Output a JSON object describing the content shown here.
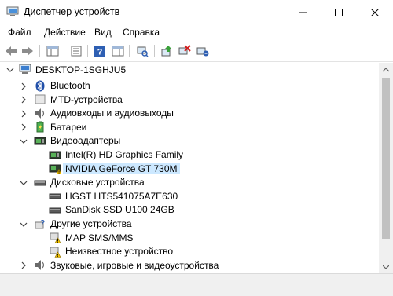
{
  "window": {
    "title": "Диспетчер устройств"
  },
  "menu": {
    "items": [
      "Файл",
      "Действие",
      "Вид",
      "Справка"
    ]
  },
  "tree": {
    "root": "DESKTOP-1SGHJU5",
    "items": [
      {
        "label": "Bluetooth",
        "icon": "bluetooth-icon",
        "expanded": false
      },
      {
        "label": "MTD-устройства",
        "icon": "mtd-device-icon",
        "expanded": false
      },
      {
        "label": "Аудиовходы и аудиовыходы",
        "icon": "audio-icon",
        "expanded": false
      },
      {
        "label": "Батареи",
        "icon": "battery-icon",
        "expanded": false
      },
      {
        "label": "Видеоадаптеры",
        "icon": "display-adapter-icon",
        "expanded": true
      },
      {
        "label": "Intel(R) HD Graphics Family",
        "icon": "display-adapter-icon",
        "child": true
      },
      {
        "label": "NVIDIA GeForce GT 730M",
        "icon": "display-adapter-warning-icon",
        "child": true,
        "selected": true
      },
      {
        "label": "Дисковые устройства",
        "icon": "disk-icon",
        "expanded": true
      },
      {
        "label": "HGST HTS541075A7E630",
        "icon": "disk-icon",
        "child": true
      },
      {
        "label": "SanDisk SSD U100 24GB",
        "icon": "disk-icon",
        "child": true
      },
      {
        "label": "Другие устройства",
        "icon": "unknown-device-icon",
        "expanded": true
      },
      {
        "label": "MAP SMS/MMS",
        "icon": "unknown-device-warning-icon",
        "child": true
      },
      {
        "label": "Неизвестное устройство",
        "icon": "unknown-device-warning-icon",
        "child": true
      },
      {
        "label": "Звуковые, игровые и видеоустройства",
        "icon": "sound-icon",
        "expanded": false
      }
    ]
  },
  "colors": {
    "selection": "#cce8ff",
    "accent": "#0078d7",
    "warning": "#f5c400"
  }
}
